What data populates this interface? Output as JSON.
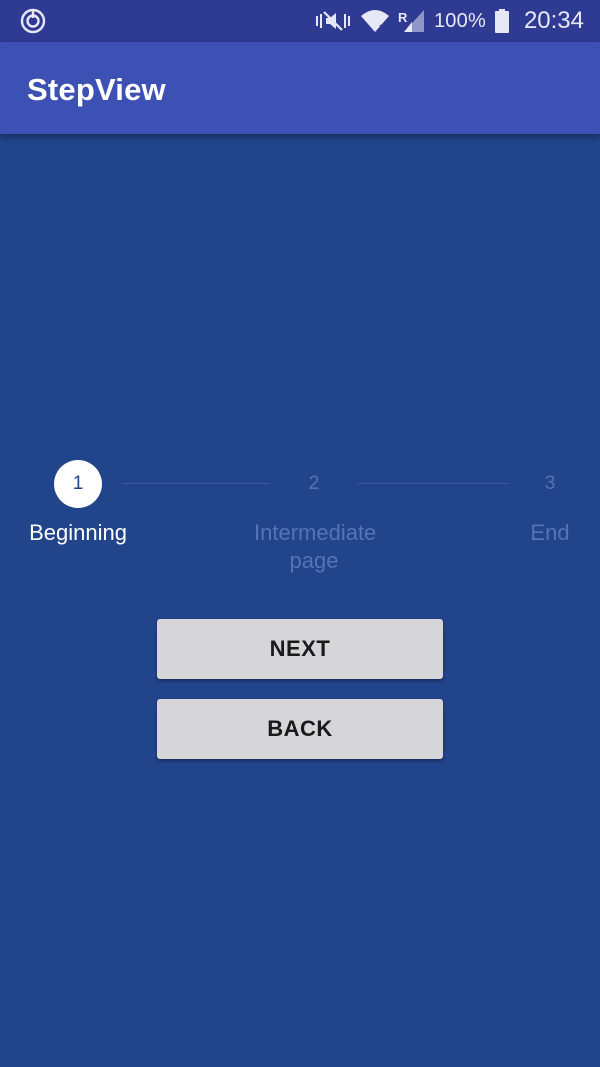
{
  "status_bar": {
    "battery_percent": "100%",
    "time": "20:34",
    "icons": [
      "sync-icon",
      "mute-vibrate-icon",
      "wifi-icon",
      "signal-roaming-icon",
      "battery-icon"
    ]
  },
  "app_bar": {
    "title": "StepView"
  },
  "stepper": {
    "current_step": 1,
    "steps": [
      {
        "number": "1",
        "label": "Beginning"
      },
      {
        "number": "2",
        "label": "Intermediate page"
      },
      {
        "number": "3",
        "label": "End"
      }
    ]
  },
  "buttons": {
    "next_label": "NEXT",
    "back_label": "BACK"
  },
  "colors": {
    "background": "#22448a",
    "app_bar": "#3d51b5",
    "status_bar": "#2f3a93",
    "active": "#ffffff",
    "inactive": "#5673b4",
    "button": "#d6d6d8"
  }
}
